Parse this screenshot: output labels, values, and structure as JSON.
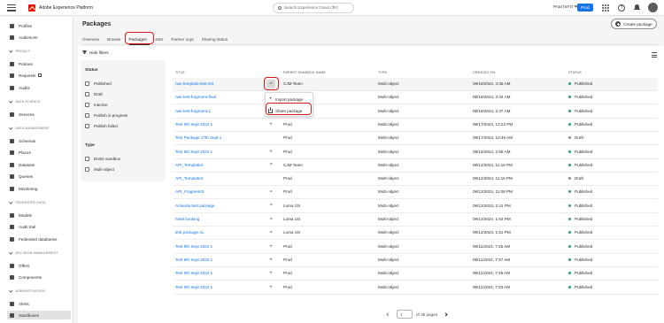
{
  "app": {
    "title": "Adobe Experience Platform",
    "search_placeholder": "Search Experience Cloud (⌘/)",
    "org_label": "Prod (VA7)",
    "sandbox_badge": "Prod"
  },
  "sidebar": {
    "top": [
      {
        "label": "Profiles",
        "icon": "profiles-icon"
      },
      {
        "label": "Audiences",
        "icon": "audiences-icon"
      }
    ],
    "privacy": {
      "title": "PRIVACY",
      "items": [
        {
          "label": "Policies",
          "icon": "policies-icon"
        },
        {
          "label": "Requests",
          "icon": "requests-icon"
        },
        {
          "label": "Audits",
          "icon": "audits-icon"
        }
      ]
    },
    "data_science": {
      "title": "DATA SCIENCE",
      "items": [
        {
          "label": "Services",
          "icon": "services-icon"
        }
      ]
    },
    "data_management": {
      "title": "DATA MANAGEMENT",
      "items": [
        {
          "label": "Schemas",
          "icon": "schemas-icon"
        },
        {
          "label": "Places",
          "icon": "places-icon"
        },
        {
          "label": "Datasets",
          "icon": "datasets-icon"
        },
        {
          "label": "Queries",
          "icon": "queries-icon"
        },
        {
          "label": "Monitoring",
          "icon": "monitoring-icon"
        }
      ]
    },
    "federated_data": {
      "title": "FEDERATED DATA",
      "items": [
        {
          "label": "Models",
          "icon": "models-icon"
        },
        {
          "label": "Audit trail",
          "icon": "audit-trail-icon"
        },
        {
          "label": "Federated databases",
          "icon": "federated-databases-icon"
        }
      ]
    },
    "decision_management": {
      "title": "DECISION MANAGEMENT",
      "items": [
        {
          "label": "Offers",
          "icon": "offers-icon"
        },
        {
          "label": "Components",
          "icon": "components-icon"
        }
      ]
    },
    "administration": {
      "title": "ADMINISTRATION",
      "items": [
        {
          "label": "Alerts",
          "icon": "alerts-icon"
        },
        {
          "label": "Sandboxes",
          "icon": "sandboxes-icon"
        }
      ]
    }
  },
  "page": {
    "title": "Packages",
    "create_button": "Create package",
    "tabs": [
      "Overview",
      "Browse",
      "Packages",
      "Jobs",
      "Partner orgs",
      "Sharing status"
    ],
    "active_tab": "Packages",
    "hide_filters": "Hide filters"
  },
  "filters": {
    "status_title": "Status",
    "status_options": [
      "Published",
      "Draft",
      "Inactive",
      "Publish in progress",
      "Publish failed"
    ],
    "type_title": "Type",
    "type_options": [
      "Entire sandbox",
      "Multi-object"
    ]
  },
  "table": {
    "headers": {
      "title": "TITLE",
      "parent": "PARENT SANDBOX NAME",
      "type": "TYPE",
      "created": "CREATED ON",
      "status": "STATUS"
    },
    "rows": [
      {
        "title": "nav-template-test-stit",
        "parent": "CJM Team",
        "type": "Multi-object",
        "created": "09/18/2024, 4:35 AM",
        "status": "Published",
        "action": "more"
      },
      {
        "title": "nav-test-fragment-final",
        "parent": "",
        "type": "Multi-object",
        "created": "09/18/2024, 2:44 AM",
        "status": "Published",
        "action": ""
      },
      {
        "title": "nav-test-fragment-1",
        "parent": "",
        "type": "Multi-object",
        "created": "09/18/2024, 2:37 AM",
        "status": "Published",
        "action": ""
      },
      {
        "title": "Test 9th Sept 2024 1",
        "parent": "Prod",
        "type": "Multi-object",
        "created": "09/17/2024, 12:23 PM",
        "status": "Published",
        "action": "add"
      },
      {
        "title": "Test Package 17th Sept 1",
        "parent": "Prod",
        "type": "Multi-object",
        "created": "09/17/2024, 10:46 AM",
        "status": "Draft",
        "action": ""
      },
      {
        "title": "Test 9th Sept 2024 1",
        "parent": "Prod",
        "type": "Multi-object",
        "created": "09/16/2024, 2:56 AM",
        "status": "Published",
        "action": "add"
      },
      {
        "title": "API_Template4",
        "parent": "CJM Team",
        "type": "Multi-object",
        "created": "09/12/2024, 11:16 PM",
        "status": "Published",
        "action": "more"
      },
      {
        "title": "API_Template3",
        "parent": "Prod",
        "type": "Multi-object",
        "created": "09/12/2024, 11:16 PM",
        "status": "Draft",
        "action": ""
      },
      {
        "title": "API_Fragment3",
        "parent": "Prod",
        "type": "Multi-object",
        "created": "09/12/2024, 11:08 PM",
        "status": "Published",
        "action": "more"
      },
      {
        "title": "Amanda test package",
        "parent": "Luma US",
        "type": "Multi-object",
        "created": "09/12/2024, 2:41 PM",
        "status": "Published",
        "action": "more"
      },
      {
        "title": "hotel booking",
        "parent": "Luma US",
        "type": "Multi-object",
        "created": "09/12/2024, 1:53 PM",
        "status": "Published",
        "action": "more"
      },
      {
        "title": "test package AL",
        "parent": "Luma US",
        "type": "Multi-object",
        "created": "09/12/2024, 1:51 PM",
        "status": "Published",
        "action": "more"
      },
      {
        "title": "Test 9th Sept 2024 1",
        "parent": "Prod",
        "type": "Multi-object",
        "created": "09/11/2024, 7:35 AM",
        "status": "Published",
        "action": "add"
      },
      {
        "title": "Test 9th Sept 2024 1",
        "parent": "Prod",
        "type": "Multi-object",
        "created": "09/11/2024, 7:37 AM",
        "status": "Published",
        "action": "add"
      },
      {
        "title": "Test 9th Sept 2024 1",
        "parent": "Prod",
        "type": "Multi-object",
        "created": "09/11/2024, 7:35 AM",
        "status": "Published",
        "action": "add"
      },
      {
        "title": "Test 9th Sept 2024 1",
        "parent": "Prod",
        "type": "Multi-object",
        "created": "09/11/2024, 7:33 AM",
        "status": "Published",
        "action": "add"
      }
    ]
  },
  "popover": {
    "import_label": "Import package",
    "share_label": "Share package"
  },
  "pagination": {
    "current_page": "1",
    "of_label": "of 36 pages"
  },
  "colors": {
    "accent": "#1473e6",
    "published": "#2d9d78",
    "draft": "#8e8e8e",
    "highlight": "#d7191a"
  }
}
